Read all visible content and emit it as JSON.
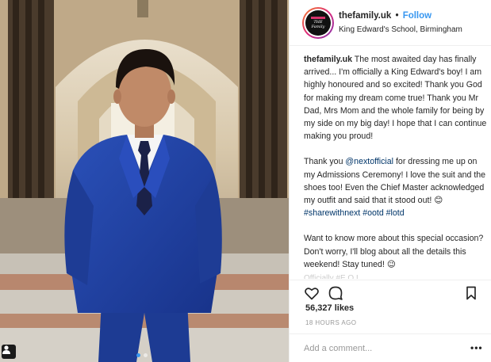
{
  "post": {
    "username": "thefamily.uk",
    "separator": "•",
    "follow_label": "Follow",
    "location": "King Edward's School, Birmingham",
    "avatar_text_1": "THE",
    "avatar_text_2": "Family",
    "caption": {
      "p1_user": "thefamily.uk",
      "p1_text": " The most awaited day has finally arrived... I'm officially a King Edward's boy! I am highly honoured and so excited! Thank you God for making my dream come true! Thank you Mr Dad, Mrs Mom and the whole family for being by my side on my big day! I hope that I can continue making you proud!",
      "p2_before": "Thank you ",
      "p2_mention": "@nextofficial",
      "p2_after": " for dressing me up on my Admissions Ceremony! I love the suit and the shoes too! Even the Chief Master acknowledged my outfit and said that it stood out! 😊",
      "p2_hashtags": "#sharewithnext #ootd #lotd",
      "p3_text": "Want to know more about this special occasion? Don't worry, I'll blog about all the details this weekend! Stay tuned! 😉",
      "p4_partial": "Officially #E O L..."
    },
    "likes": "56,327 likes",
    "time_ago": "18 HOURS AGO",
    "comment_placeholder": "Add a comment...",
    "more_label": "•••"
  },
  "icons": {
    "like": "heart-icon",
    "comment": "speech-bubble-icon",
    "save": "bookmark-icon",
    "tag": "user-tag-icon"
  },
  "colors": {
    "accent": "#3897f0",
    "text": "#262626",
    "muted": "#999999",
    "link": "#003569",
    "suit": "#1f3f9e"
  },
  "carousel": {
    "count": 2,
    "active": 1
  }
}
